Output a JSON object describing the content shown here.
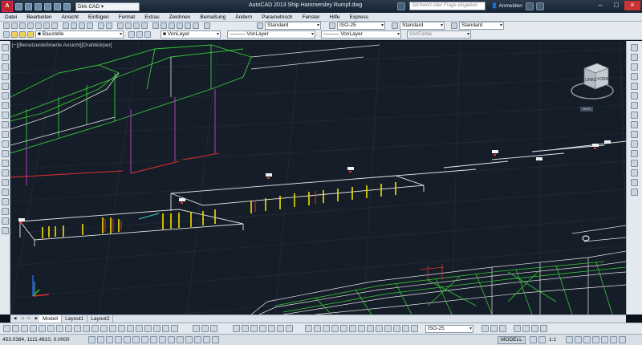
{
  "window": {
    "title": "AutoCAD 2013  Ship Hammersley Rumpf.dwg",
    "workspace": "Dirk CAD",
    "search_placeholder": "Stichwort oder Frage eingeben",
    "login": "Anmelden"
  },
  "menu": [
    "Datei",
    "Bearbeiten",
    "Ansicht",
    "Einfügen",
    "Format",
    "Extras",
    "Zeichnen",
    "Bemaßung",
    "Ändern",
    "Parametrisch",
    "Fenster",
    "Hilfe",
    "Express"
  ],
  "toolbar1": {
    "textstyle": "Standard",
    "dimstyle": "ISO-25",
    "tablestyle": "Standard",
    "mleaderstyle": "Standard"
  },
  "toolbar2": {
    "layer": "Baustelle",
    "color": "VonLayer",
    "linetype": "VonLayer",
    "lineweight": "VonLayer",
    "plotstyle": "VonFarbe"
  },
  "viewport": {
    "label": "[−][Benutzerdefinierte Ansicht][Drahtkörper]",
    "viewcube_faces": [
      "LINKS",
      "VORNE"
    ],
    "navbar_text": "WKS"
  },
  "tabs": [
    "Modell",
    "Layout1",
    "Layout2"
  ],
  "statusbar": {
    "coords": "453.0384, 1111.4810, 0.0000",
    "annoscale": "ISO-25",
    "model": "MODELL",
    "scale": "1:1"
  },
  "colors": {
    "viewport_bg": "#151d28",
    "grid": "#2a3542",
    "green": "#3cd23c",
    "white": "#e8e8e8",
    "yellow": "#f0e000",
    "magenta": "#c040c0",
    "red": "#e03030"
  }
}
